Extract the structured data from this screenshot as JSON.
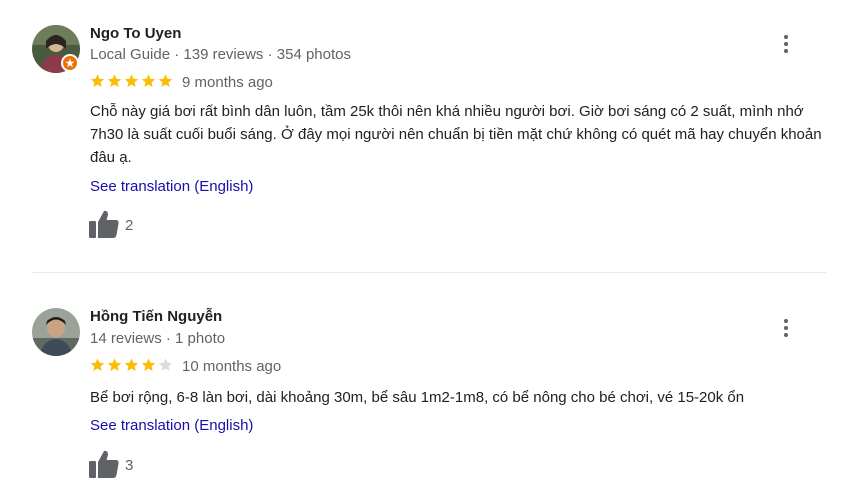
{
  "reviews": [
    {
      "author": "Ngo To Uyen",
      "meta": "Local Guide · 139 reviews · 354 photos",
      "rating": 5,
      "date": "9 months ago",
      "text": "Chỗ này giá bơi rất bình dân luôn, tầm 25k thôi nên khá nhiều người bơi. Giờ bơi sáng có 2 suất, mình nhớ 7h30 là suất cuối buổi sáng. Ở đây mọi người nên chuẩn bị tiền mặt chứ không có quét mã hay chuyển khoản đâu ạ.",
      "translation_link": "See translation (English)",
      "likes": "2",
      "local_guide": true
    },
    {
      "author": "Hồng Tiến Nguyễn",
      "meta": "14 reviews · 1 photo",
      "rating": 4,
      "date": "10 months ago",
      "text": "Bể bơi rộng, 6-8 làn bơi, dài khoảng 30m, bể sâu 1m2-1m8, có bể nông cho bé chơi, vé 15-20k ổn",
      "translation_link": "See translation (English)",
      "likes": "3",
      "local_guide": false
    }
  ],
  "colors": {
    "star_filled": "#fbbc04",
    "star_empty": "#dadce0",
    "link": "#1a0dab",
    "secondary_text": "#5f6368",
    "badge": "#e8710a"
  },
  "icons": {
    "like": "thumbs-up-icon",
    "more": "more-vert-icon",
    "badge": "local-guide-badge-icon",
    "star": "star-icon"
  }
}
